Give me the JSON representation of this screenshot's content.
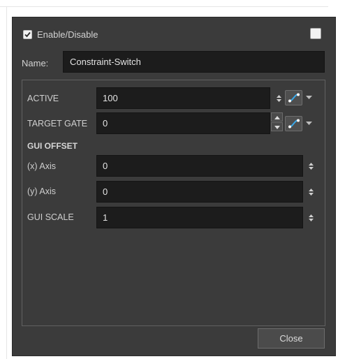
{
  "enable": {
    "label": "Enable/Disable",
    "checked": true
  },
  "name": {
    "label": "Name:",
    "value": "Constraint-Switch"
  },
  "properties": {
    "active": {
      "label": "ACTIVE",
      "value": "100"
    },
    "target_gate": {
      "label": "TARGET GATE",
      "value": "0"
    },
    "gui_offset": {
      "title": "GUI OFFSET",
      "x_axis": {
        "label": "(x) Axis",
        "value": "0"
      },
      "y_axis": {
        "label": "(y) Axis",
        "value": "0"
      }
    },
    "gui_scale": {
      "label": "GUI SCALE",
      "value": "1"
    }
  },
  "footer": {
    "close_label": "Close"
  },
  "colors": {
    "dialog_bg": "#3b3b3b",
    "field_bg": "#1c1c1c",
    "function_icon": "#3aa8e8"
  },
  "icons": [
    "checkmark-icon",
    "updown-icon",
    "spin-up-icon",
    "spin-down-icon",
    "function-curve-icon",
    "caret-down-icon"
  ]
}
